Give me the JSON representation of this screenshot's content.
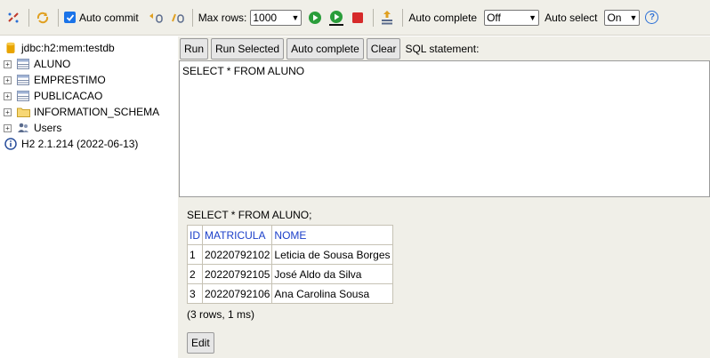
{
  "toolbar": {
    "icons": [
      "disconnect-icon",
      "refresh-icon",
      "rollback-icon",
      "commit-icon",
      "run-icon",
      "run-selected-icon",
      "stop-icon",
      "history-icon",
      "help-icon"
    ],
    "auto_commit_label": "Auto commit",
    "max_rows_label": "Max rows:",
    "max_rows_value": "1000",
    "auto_complete_label": "Auto complete",
    "auto_complete_value": "Off",
    "auto_select_label": "Auto select",
    "auto_select_value": "On",
    "help_glyph": "?"
  },
  "tree": {
    "connection": "jdbc:h2:mem:testdb",
    "items": [
      {
        "label": "ALUNO",
        "icon": "table-icon"
      },
      {
        "label": "EMPRESTIMO",
        "icon": "table-icon"
      },
      {
        "label": "PUBLICACAO",
        "icon": "table-icon"
      },
      {
        "label": "INFORMATION_SCHEMA",
        "icon": "folder-icon"
      },
      {
        "label": "Users",
        "icon": "users-icon"
      }
    ],
    "version": "H2 2.1.214 (2022-06-13)",
    "toggle_glyph": "+"
  },
  "buttons": {
    "run": "Run",
    "run_selected": "Run Selected",
    "auto_complete": "Auto complete",
    "clear": "Clear",
    "sql_statement_label": "SQL statement:"
  },
  "editor": {
    "text": "SELECT * FROM ALUNO"
  },
  "results": {
    "sql": "SELECT * FROM ALUNO;",
    "columns": [
      "ID",
      "MATRICULA",
      "NOME"
    ],
    "rows": [
      [
        "1",
        "20220792102",
        "Leticia de Sousa Borges"
      ],
      [
        "2",
        "20220792105",
        "José Aldo da Silva"
      ],
      [
        "3",
        "20220792106",
        "Ana Carolina Sousa"
      ]
    ],
    "count": "(3 rows, 1 ms)",
    "edit_label": "Edit"
  },
  "colors": {
    "toolbar_bg": "#f0efe8",
    "header_text": "#1b3fc9",
    "run_green": "#2a9d3a",
    "stop_red": "#d62a2a"
  }
}
